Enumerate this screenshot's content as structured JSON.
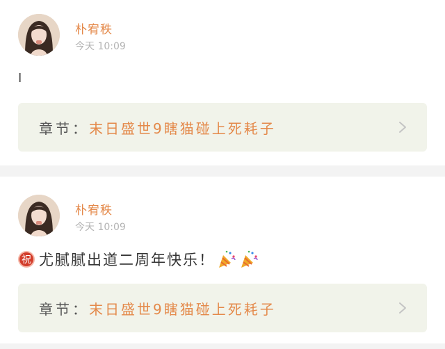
{
  "posts": [
    {
      "username": "朴宥秩",
      "time": "今天 10:09",
      "content": "I",
      "chapter": {
        "label": "章节：",
        "title": "末日盛世9瞎猫碰上死耗子"
      }
    },
    {
      "username": "朴宥秩",
      "time": "今天 10:09",
      "badge": "祝",
      "content": "尤腻腻出道二周年快乐！",
      "emoji": "party-popper-icon",
      "chapter": {
        "label": "章节：",
        "title": "末日盛世9瞎猫碰上死耗子"
      }
    }
  ],
  "colors": {
    "accent": "#e4894a",
    "chapter_bg": "#f1f3ea",
    "separator": "#f3f3f3",
    "time": "#b3b3b3"
  }
}
